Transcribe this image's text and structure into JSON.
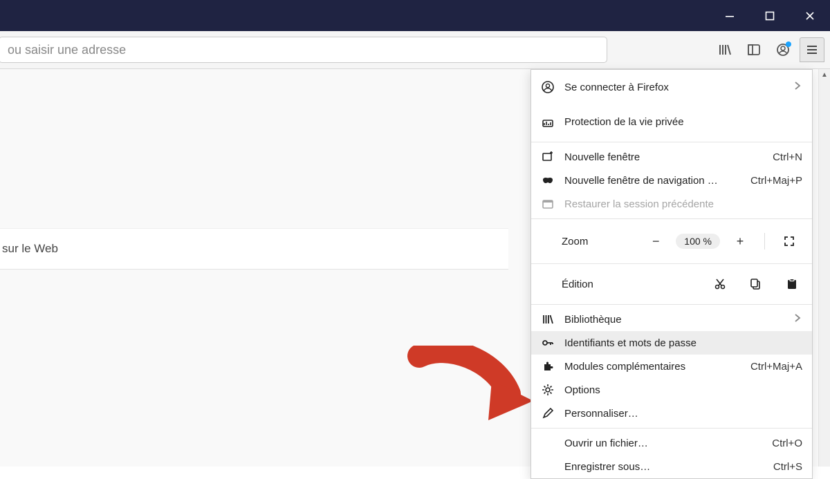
{
  "urlbar": {
    "placeholder": "ou saisir une adresse"
  },
  "search_strip": {
    "label": "sur le Web"
  },
  "menu": {
    "fx_signin": "Se connecter à Firefox",
    "privacy": "Protection de la vie privée",
    "new_window": {
      "label": "Nouvelle fenêtre",
      "shortcut": "Ctrl+N"
    },
    "new_private": {
      "label": "Nouvelle fenêtre de navigation …",
      "shortcut": "Ctrl+Maj+P"
    },
    "restore": "Restaurer la session précédente",
    "zoom": {
      "label": "Zoom",
      "value": "100 %"
    },
    "edit": {
      "label": "Édition"
    },
    "library": "Bibliothèque",
    "logins": "Identifiants et mots de passe",
    "addons": {
      "label": "Modules complémentaires",
      "shortcut": "Ctrl+Maj+A"
    },
    "options": "Options",
    "customize": "Personnaliser…",
    "open_file": {
      "label": "Ouvrir un fichier…",
      "shortcut": "Ctrl+O"
    },
    "save_as": {
      "label": "Enregistrer sous…",
      "shortcut": "Ctrl+S"
    }
  }
}
